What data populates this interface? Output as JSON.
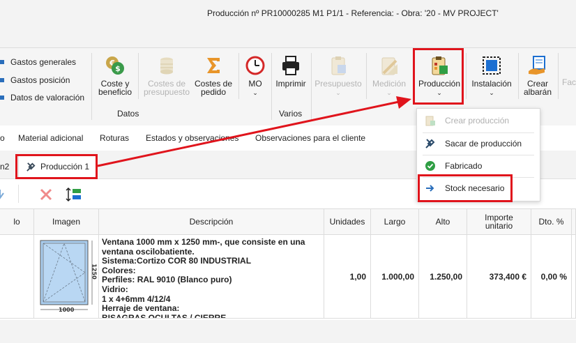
{
  "window": {
    "title": "Producción nº PR10000285 M1 P1/1 - Referencia:  - Obra: '20 - MV PROJECT'"
  },
  "ribbon": {
    "links": [
      "Gastos generales",
      "Gastos posición",
      "Datos de valoración"
    ],
    "buttons": {
      "coste_line1": "Coste y",
      "coste_line2": "beneficio",
      "costes_presupuesto_line1": "Costes de",
      "costes_presupuesto_line2": "presupuesto",
      "costes_pedido_line1": "Costes de",
      "costes_pedido_line2": "pedido",
      "mo": "MO",
      "imprimir": "Imprimir",
      "presupuesto": "Presupuesto",
      "medicion": "Medición",
      "produccion": "Producción",
      "instalacion": "Instalación",
      "crear_albaran_line1": "Crear",
      "crear_albaran_line2": "albarán",
      "truncated": "Fac"
    },
    "groups": {
      "datos": "Datos",
      "varios": "Varios"
    }
  },
  "tabs": [
    "o",
    "Material adicional",
    "Roturas",
    "Estados y observaciones",
    "Observaciones para el cliente"
  ],
  "subtabs": {
    "partial": "n2",
    "active": "Producción 1"
  },
  "dropdown": {
    "items": [
      {
        "label": "Crear producción",
        "enabled": false
      },
      {
        "label": "Sacar de producción",
        "enabled": true
      },
      {
        "label": "Fabricado",
        "enabled": true
      },
      {
        "label": "Stock necesario",
        "enabled": true
      }
    ]
  },
  "table": {
    "headers": {
      "c0": "lo",
      "imagen": "Imagen",
      "descripcion": "Descripción",
      "unidades": "Unidades",
      "largo": "Largo",
      "alto": "Alto",
      "importe": "Importe\nunitario",
      "dto": "Dto. %"
    },
    "row": {
      "description": "Ventana 1000 mm x 1250 mm-, que consiste en una\nventana oscilobatiente.\nSistema:Cortizo COR 80 INDUSTRIAL\nColores:\nPerfiles: RAL 9010 (Blanco puro)\nVidrio:\n1 x 4+6mm 4/12/4\nHerraje de ventana:\nBISAGRAS OCULTAS / CIERRE",
      "unidades": "1,00",
      "largo": "1.000,00",
      "alto": "1.250,00",
      "importe": "373,400 €",
      "dto": "0,00 %",
      "image_width_label": "1000",
      "image_height_label": "1250"
    }
  },
  "colors": {
    "highlight": "#e0141c",
    "accent": "#2a6ebb"
  }
}
